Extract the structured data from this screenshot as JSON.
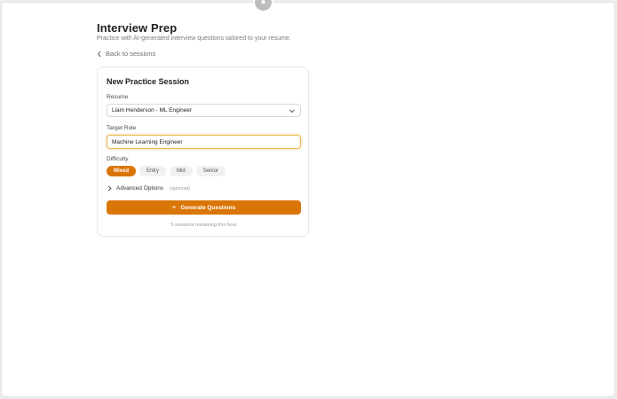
{
  "header": {
    "title": "Interview Prep",
    "subtitle": "Practice with AI-generated interview questions tailored to your resume."
  },
  "nav": {
    "back_label": "Back to sessions"
  },
  "card": {
    "title": "New Practice Session",
    "resume": {
      "label": "Resume",
      "selected": "Liam Henderson - ML Engineer"
    },
    "target_role": {
      "label": "Target Role",
      "value": "Machine Learning Engineer"
    },
    "difficulty": {
      "label": "Difficulty",
      "options": [
        "Mixed",
        "Entry",
        "Mid",
        "Senior"
      ],
      "selected": "Mixed"
    },
    "advanced": {
      "label": "Advanced Options",
      "hint": "(optional)"
    },
    "generate_label": "Generate Questions",
    "remaining_text": "5 sessions remaining this hour"
  },
  "colors": {
    "accent": "#d97607",
    "focus_ring": "#e9b84c",
    "background": "#ffffff"
  },
  "icons": {
    "back": "chevron-left-icon",
    "select": "chevron-down-icon",
    "advanced": "chevron-right-icon",
    "generate": "plus-icon"
  }
}
